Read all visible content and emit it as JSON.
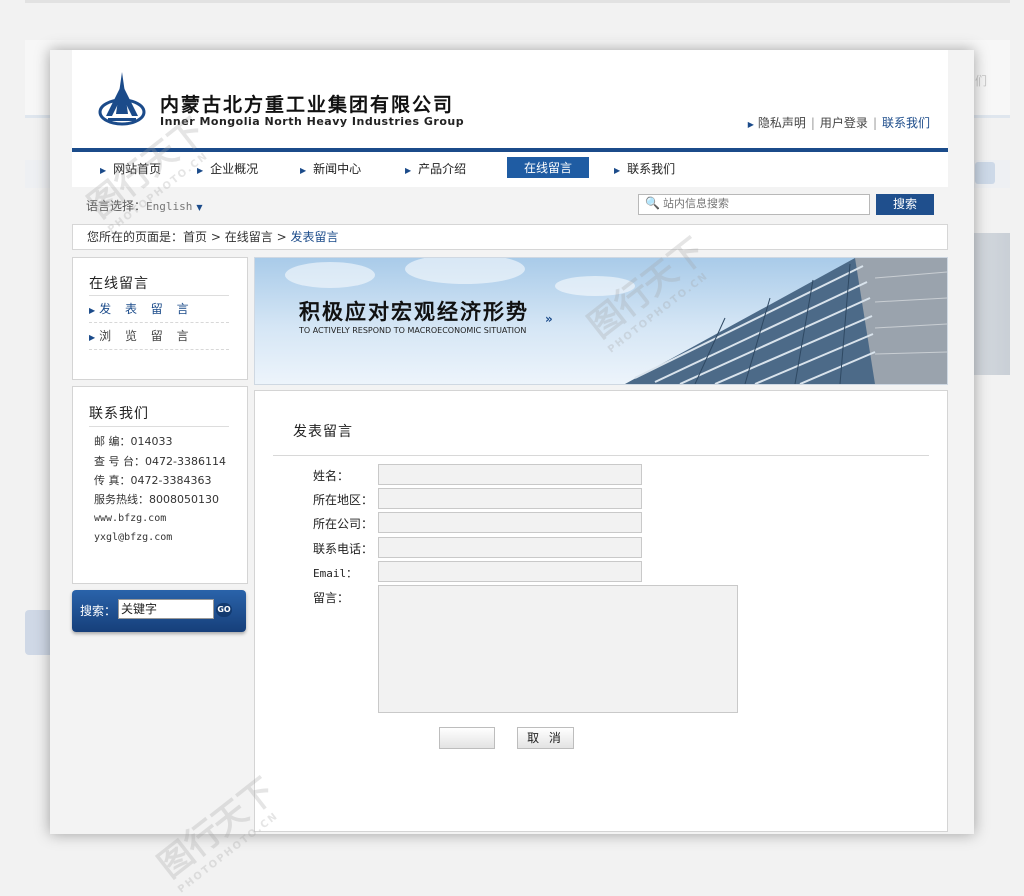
{
  "header": {
    "company_cn": "内蒙古北方重工业集团有限公司",
    "company_en": "Inner Mongolia North Heavy Industries Group",
    "top_links": [
      "隐私声明",
      "用户登录",
      "联系我们"
    ]
  },
  "nav": {
    "items": [
      "网站首页",
      "企业概况",
      "新闻中心",
      "产品介绍",
      "在线留言",
      "联系我们"
    ],
    "active": "在线留言"
  },
  "lang": {
    "label": "语言选择：",
    "value": "English"
  },
  "search": {
    "placeholder": "站内信息搜索",
    "button": "搜索"
  },
  "breadcrumb": {
    "prefix": "您所在的页面是：",
    "home": "首页",
    "section": "在线留言",
    "current": "发表留言",
    "sep": ">"
  },
  "sidebar": {
    "menu_title": "在线留言",
    "menu_items": [
      "发 表 留 言",
      "浏 览 留 言"
    ],
    "contact_title": "联系我们",
    "contact_lines": [
      "邮  编：014033",
      "查 号 台：0472-3386114",
      "传  真：0472-3384363",
      "服务热线：8008050130",
      "www.bfzg.com",
      "yxgl@bfzg.com"
    ],
    "search_label": "搜索：",
    "search_value": "关键字",
    "go": "GO"
  },
  "banner": {
    "title": "积极应对宏观经济形势",
    "subtitle": "TO ACTIVELY RESPOND TO MACROECONOMIC SITUATION",
    "chevron": "»"
  },
  "form": {
    "title": "发表留言",
    "labels": {
      "name": "姓名：",
      "region": "所在地区：",
      "company": "所在公司：",
      "phone": "联系电话：",
      "email": "Email：",
      "message": "留言："
    },
    "submit": "",
    "cancel": "取 消"
  },
  "watermark": {
    "text": "图行天下",
    "sub": "PHOTOPHOTO.CN"
  },
  "background": {
    "link": "们"
  },
  "colors": {
    "brand": "#1b4b8a",
    "active_nav": "#1f5ca3",
    "search_button": "#1f4f8d"
  }
}
